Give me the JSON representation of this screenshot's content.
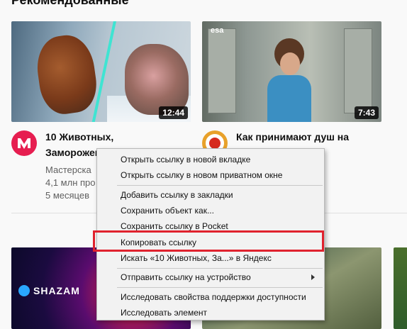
{
  "section": {
    "heading": "Рекомендованные"
  },
  "videos": [
    {
      "duration": "12:44",
      "title": "10 Животных,",
      "title_line2": "Заморожен",
      "channel": "Мастерска",
      "views": "4,1 млн про",
      "age": "5 месяцев"
    },
    {
      "duration": "7:43",
      "title": "Как принимают душ на",
      "thumb_logo": "esa"
    }
  ],
  "bottom_row": {
    "shazam_label": "SHAZAM"
  },
  "context_menu": {
    "items": [
      {
        "label": "Открыть ссылку в новой вкладке"
      },
      {
        "label": "Открыть ссылку в новом приватном окне"
      },
      {
        "label": "Добавить ссылку в закладки"
      },
      {
        "label": "Сохранить объект как..."
      },
      {
        "label": "Сохранить ссылку в Pocket"
      },
      {
        "label": "Копировать ссылку"
      },
      {
        "label": "Искать «10 Животных, За...» в Яндекс"
      },
      {
        "label": "Отправить ссылку на устройство"
      },
      {
        "label": "Исследовать свойства поддержки доступности"
      },
      {
        "label": "Исследовать элемент"
      }
    ]
  },
  "colors": {
    "highlight_border": "#e0222e",
    "duration_bg": "#000000",
    "avatar1_bg": "#e61e50"
  }
}
